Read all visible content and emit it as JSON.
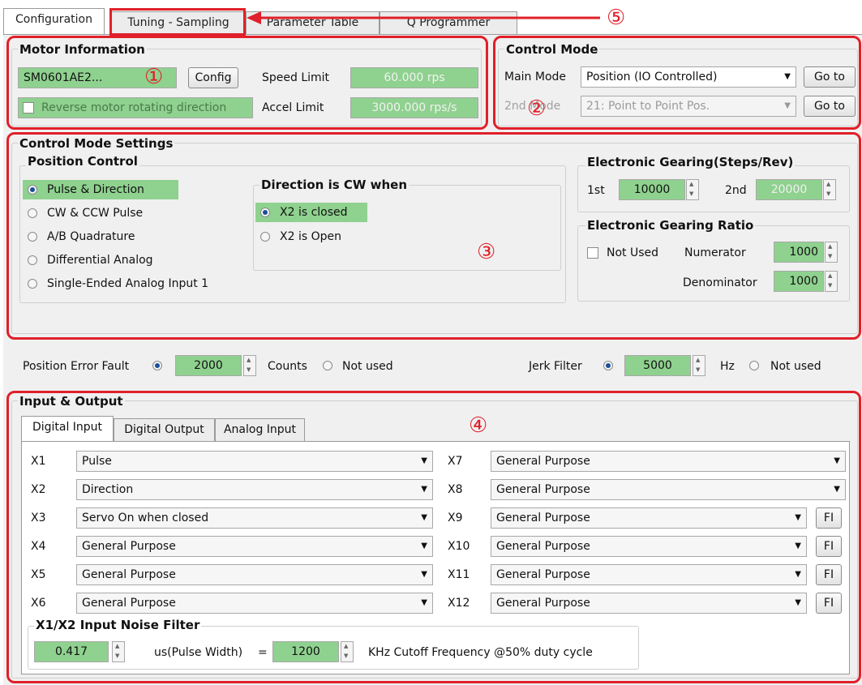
{
  "tabs": [
    "Configuration",
    "Tuning - Sampling",
    "Parameter Table",
    "Q Programmer"
  ],
  "motor_info": {
    "title": "Motor Information",
    "motor_name": "SM0601AE2...",
    "config_button": "Config",
    "speed_limit_label": "Speed Limit",
    "speed_limit_value": "60.000 rps",
    "accel_limit_label": "Accel Limit",
    "accel_limit_value": "3000.000 rps/s",
    "reverse_label": "Reverse motor rotating direction"
  },
  "control_mode": {
    "title": "Control Mode",
    "main_mode_label": "Main Mode",
    "main_mode_value": "Position (IO Controlled)",
    "second_mode_label": "2nd Mode",
    "second_mode_value": "21: Point to Point Pos.",
    "goto_label": "Go to"
  },
  "settings": {
    "title": "Control Mode Settings",
    "position_control_title": "Position Control",
    "position_options": [
      "Pulse & Direction",
      "CW & CCW Pulse",
      "A/B Quadrature",
      "Differential Analog",
      "Single-Ended Analog Input 1"
    ],
    "direction_title": "Direction is CW when",
    "direction_options": [
      "X2 is closed",
      "X2 is Open"
    ],
    "gearing_title": "Electronic Gearing(Steps/Rev)",
    "first_label": "1st",
    "first_value": "10000",
    "second_label": "2nd",
    "second_value": "20000",
    "ratio_title": "Electronic Gearing Ratio",
    "not_used_label": "Not Used",
    "numerator_label": "Numerator",
    "numerator_value": "1000",
    "denominator_label": "Denominator",
    "denominator_value": "1000"
  },
  "fault_row": {
    "position_error_label": "Position Error Fault",
    "position_error_value": "2000",
    "counts_label": "Counts",
    "not_used_label": "Not used",
    "jerk_label": "Jerk Filter",
    "jerk_value": "5000",
    "hz_label": "Hz"
  },
  "io": {
    "title": "Input & Output",
    "tabs": [
      "Digital Input",
      "Digital Output",
      "Analog Input"
    ],
    "left_inputs": [
      {
        "label": "X1",
        "value": "Pulse"
      },
      {
        "label": "X2",
        "value": "Direction"
      },
      {
        "label": "X3",
        "value": "Servo On when closed"
      },
      {
        "label": "X4",
        "value": "General Purpose"
      },
      {
        "label": "X5",
        "value": "General Purpose"
      },
      {
        "label": "X6",
        "value": "General Purpose"
      }
    ],
    "right_inputs": [
      {
        "label": "X7",
        "value": "General Purpose"
      },
      {
        "label": "X8",
        "value": "General Purpose"
      },
      {
        "label": "X9",
        "value": "General Purpose"
      },
      {
        "label": "X10",
        "value": "General Purpose"
      },
      {
        "label": "X11",
        "value": "General Purpose"
      },
      {
        "label": "X12",
        "value": "General Purpose"
      }
    ],
    "fi_label": "FI",
    "noise_title": "X1/X2 Input Noise Filter",
    "noise_value": "0.417",
    "pulse_width_label": "us(Pulse Width)",
    "equals": "=",
    "cutoff_value": "1200",
    "cutoff_label": "KHz Cutoff Frequency @50% duty cycle"
  },
  "annotations": [
    "①",
    "②",
    "③",
    "④",
    "⑤"
  ]
}
